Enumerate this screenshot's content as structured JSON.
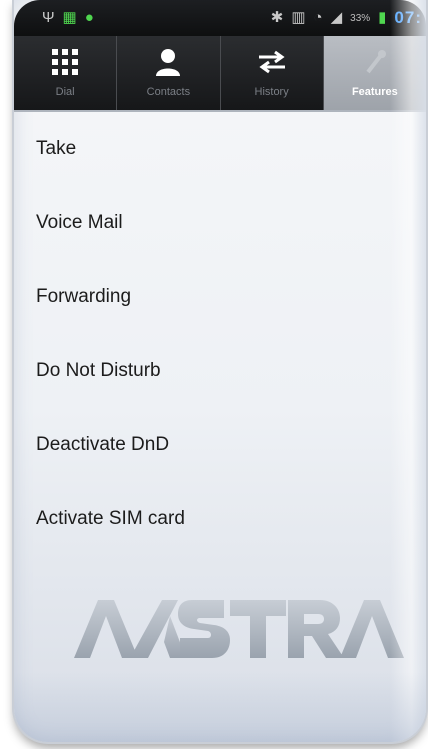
{
  "status_bar": {
    "left_icons": [
      "usb-icon",
      "apps-icon",
      "android-icon"
    ],
    "right_icons": [
      "bluetooth-icon",
      "nfc-icon",
      "wifi-icon",
      "signal-icon"
    ],
    "battery_text": "33%",
    "time": "07:"
  },
  "tabs": [
    {
      "label": "Dial",
      "icon": "dialpad-icon",
      "active": false
    },
    {
      "label": "Contacts",
      "icon": "person-icon",
      "active": false
    },
    {
      "label": "History",
      "icon": "swap-arrows-icon",
      "active": false
    },
    {
      "label": "Features",
      "icon": "features-icon",
      "active": true
    }
  ],
  "features_list": [
    {
      "label": "Take"
    },
    {
      "label": "Voice Mail"
    },
    {
      "label": "Forwarding"
    },
    {
      "label": "Do Not Disturb"
    },
    {
      "label": "Deactivate DnD"
    },
    {
      "label": "Activate SIM card"
    }
  ],
  "logo": {
    "text": "AASTRA"
  },
  "colors": {
    "tab_bar": "#1c1d1f",
    "active_tab": "#aeb2b8",
    "time": "#4ea4ff",
    "list_text": "#1c1c1c",
    "logo": "#b4bcc6"
  }
}
